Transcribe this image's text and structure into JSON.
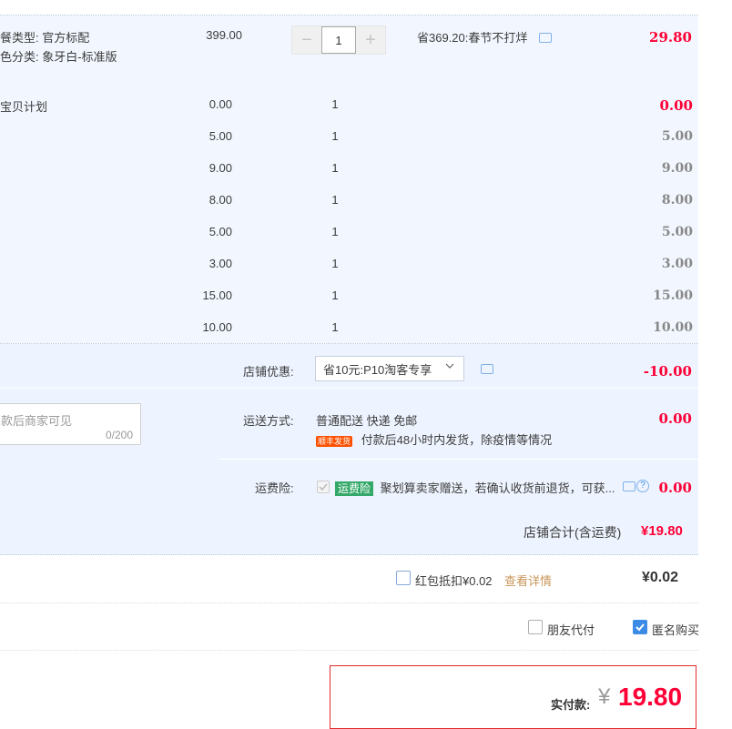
{
  "main_item": {
    "attr1": "餐类型: 官方标配",
    "attr2": "色分类: 象牙白-标准版",
    "price": "399.00",
    "quantity": "1",
    "promo": "省369.20:春节不打烊",
    "subtotal": "29.80"
  },
  "plan_label": "宝贝计划",
  "plan_rows": [
    {
      "price": "0.00",
      "qty": "1",
      "subtotal": "0.00",
      "red": true
    },
    {
      "price": "5.00",
      "qty": "1",
      "subtotal": "5.00",
      "red": false
    },
    {
      "price": "9.00",
      "qty": "1",
      "subtotal": "9.00",
      "red": false
    },
    {
      "price": "8.00",
      "qty": "1",
      "subtotal": "8.00",
      "red": false
    },
    {
      "price": "5.00",
      "qty": "1",
      "subtotal": "5.00",
      "red": false
    },
    {
      "price": "3.00",
      "qty": "1",
      "subtotal": "3.00",
      "red": false
    },
    {
      "price": "15.00",
      "qty": "1",
      "subtotal": "15.00",
      "red": false
    },
    {
      "price": "10.00",
      "qty": "1",
      "subtotal": "10.00",
      "red": false
    }
  ],
  "shop": {
    "discount_label": "店铺优惠:",
    "discount_select": "省10元:P10淘客专享",
    "discount_amount": "-10.00",
    "message_placeholder": "款后商家可见",
    "message_count": "0/200",
    "shipping_label": "运送方式:",
    "shipping_value": "普通配送 快递 免邮",
    "shipping_badge": "顺丰发货",
    "shipping_note": "付款后48小时内发货，除疫情等情况",
    "shipping_amount": "0.00",
    "insurance_label": "运费险:",
    "insurance_badge": "运费险",
    "insurance_text": "聚划算卖家赠送，若确认收货前退货，可获...",
    "insurance_amount": "0.00",
    "total_label": "店铺合计(含运费)",
    "total_amount": "¥19.80"
  },
  "redpacket": {
    "label": "红包抵扣¥0.02",
    "details": "查看详情",
    "amount": "¥0.02"
  },
  "options": {
    "friend_pay": "朋友代付",
    "anonymous": "匿名购买"
  },
  "payment": {
    "label": "实付款:",
    "currency": "¥",
    "amount": "19.80"
  },
  "colors": {
    "accent_red": "#ff0036",
    "blue_check": "#3c8ce7",
    "panel_bg": "#eef4ff"
  }
}
